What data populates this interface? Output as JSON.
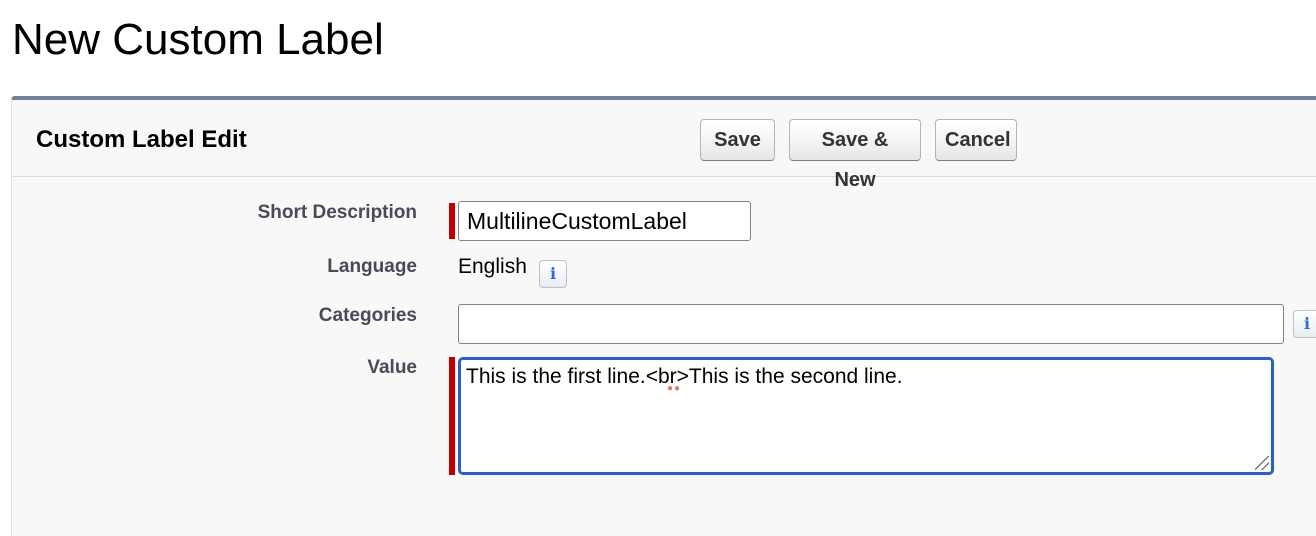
{
  "page": {
    "title": "New Custom Label"
  },
  "panel": {
    "title": "Custom Label Edit",
    "buttons": {
      "save": "Save",
      "save_new": "Save & New",
      "cancel": "Cancel"
    }
  },
  "form": {
    "short_description": {
      "label": "Short Description",
      "value": "MultilineCustomLabel"
    },
    "language": {
      "label": "Language",
      "value": "English",
      "info_icon_glyph": "i"
    },
    "categories": {
      "label": "Categories",
      "value": "",
      "info_icon_glyph": "i"
    },
    "value": {
      "label": "Value",
      "value": "This is the first line.<br>This is the second line."
    }
  },
  "colors": {
    "required_bar": "#c00000",
    "focus_border": "#2562c4",
    "panel_top_border": "#747e96",
    "info_icon": "#2a6bd6"
  }
}
